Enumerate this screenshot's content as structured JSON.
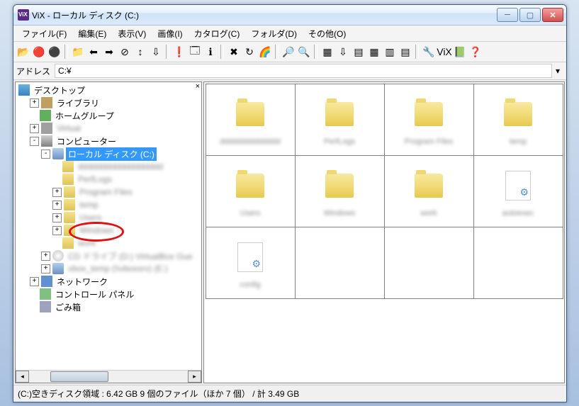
{
  "title": "ViX - ローカル ディスク (C:)",
  "menus": [
    "ファイル(F)",
    "編集(E)",
    "表示(V)",
    "画像(I)",
    "カタログ(C)",
    "フォルダ(D)",
    "その他(O)"
  ],
  "address_label": "アドレス",
  "address_value": "C:¥",
  "tree": {
    "root": "デスクトップ",
    "items": [
      {
        "ind": 1,
        "tw": "+",
        "ic": "lib",
        "lbl": "ライブラリ"
      },
      {
        "ind": 1,
        "tw": "",
        "ic": "home",
        "lbl": "ホームグループ"
      },
      {
        "ind": 1,
        "tw": "+",
        "ic": "virtual",
        "lbl": "Virtual",
        "blur": true
      },
      {
        "ind": 1,
        "tw": "-",
        "ic": "computer",
        "lbl": "コンピューター"
      },
      {
        "ind": 2,
        "tw": "-",
        "ic": "disk",
        "lbl": "ローカル ディスク (C:)",
        "sel": true
      },
      {
        "ind": 3,
        "tw": "",
        "ic": "folder",
        "lbl": "dddddddddddddddddd",
        "blur": true
      },
      {
        "ind": 3,
        "tw": "",
        "ic": "folder",
        "lbl": "PerfLogs",
        "blur": true
      },
      {
        "ind": 3,
        "tw": "+",
        "ic": "folder",
        "lbl": "Program Files",
        "blur": true
      },
      {
        "ind": 3,
        "tw": "+",
        "ic": "folder",
        "lbl": "temp",
        "blur": true
      },
      {
        "ind": 3,
        "tw": "+",
        "ic": "folder",
        "lbl": "Users",
        "blur": true
      },
      {
        "ind": 3,
        "tw": "+",
        "ic": "folder",
        "lbl": "Windows",
        "blur": true
      },
      {
        "ind": 3,
        "tw": "",
        "ic": "folder",
        "lbl": "work",
        "blur": true
      },
      {
        "ind": 2,
        "tw": "+",
        "ic": "cd",
        "lbl": "CD ドライブ (D:) VirtualBox Gue",
        "blur": true
      },
      {
        "ind": 2,
        "tw": "+",
        "ic": "disk",
        "lbl": "vbox_temp (\\\\vboxsrv) (E:)",
        "blur": true
      },
      {
        "ind": 1,
        "tw": "+",
        "ic": "net",
        "lbl": "ネットワーク"
      },
      {
        "ind": 1,
        "tw": "",
        "ic": "cpl",
        "lbl": "コントロール パネル"
      },
      {
        "ind": 1,
        "tw": "",
        "ic": "trash",
        "lbl": "ごみ箱"
      }
    ]
  },
  "files": [
    {
      "type": "folder",
      "lbl": "dddddddddddddd"
    },
    {
      "type": "folder",
      "lbl": "PerfLogs"
    },
    {
      "type": "folder",
      "lbl": "Program Files"
    },
    {
      "type": "folder",
      "lbl": "temp"
    },
    {
      "type": "folder",
      "lbl": "Users"
    },
    {
      "type": "folder",
      "lbl": "Windows"
    },
    {
      "type": "folder",
      "lbl": "work"
    },
    {
      "type": "file",
      "lbl": "autoexec"
    },
    {
      "type": "file",
      "lbl": "config"
    }
  ],
  "status": "(C:)空きディスク領域 : 6.42 GB   9 個のファイル（ほか 7 個） / 計 3.49 GB",
  "toolbar_icons": [
    "📂",
    "🔴",
    "⚫",
    "|",
    "📁",
    "⬅",
    "➡",
    "⊘",
    "↕",
    "⇩",
    "|",
    "❗",
    "🗔",
    "ℹ",
    "|",
    "✖",
    "↻",
    "🌈",
    "|",
    "🔎",
    "🔍",
    "|",
    "▦",
    "⇩",
    "▤",
    "▦",
    "▥",
    "▤",
    "|",
    "🔧",
    "ViX",
    "📗",
    "❓"
  ]
}
